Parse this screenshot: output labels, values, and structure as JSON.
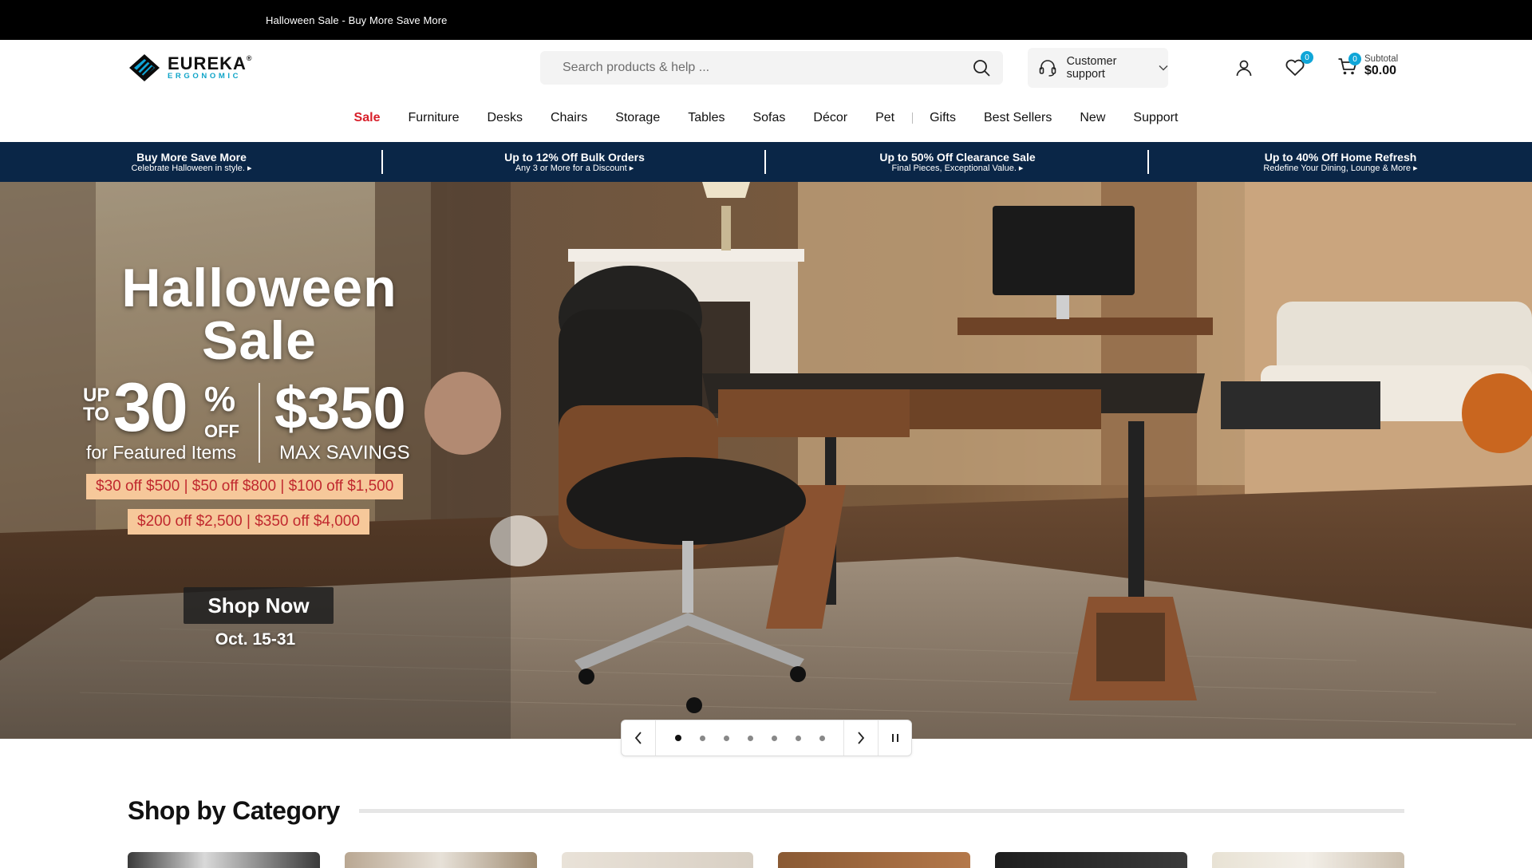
{
  "announcement": "Halloween Sale - Buy More Save More",
  "logo": {
    "brand": "EUREKA",
    "registered": "®",
    "subtitle": "ERGONOMIC"
  },
  "search": {
    "placeholder": "Search products & help ..."
  },
  "support": {
    "label": "Customer support"
  },
  "wishlist": {
    "count": "0"
  },
  "cart": {
    "count": "0",
    "subtotal_label": "Subtotal",
    "subtotal_value": "$0.00"
  },
  "nav": [
    "Sale",
    "Furniture",
    "Desks",
    "Chairs",
    "Storage",
    "Tables",
    "Sofas",
    "Décor",
    "Pet",
    "Gifts",
    "Best Sellers",
    "New",
    "Support"
  ],
  "promos": [
    {
      "title": "Buy More Save More",
      "subtitle": "Celebrate Halloween in style. ▸"
    },
    {
      "title": "Up to 12% Off Bulk Orders",
      "subtitle": "Any 3 or More for a Discount ▸"
    },
    {
      "title": "Up to 50% Off Clearance Sale",
      "subtitle": "Final Pieces, Exceptional Value. ▸"
    },
    {
      "title": "Up to 40% Off Home Refresh",
      "subtitle": "Redefine Your Dining, Lounge & More ▸"
    }
  ],
  "hero": {
    "title_line1": "Halloween",
    "title_line2": "Sale",
    "upto_line1": "UP",
    "upto_line2": "TO",
    "percent": "30",
    "percent_sign": "%",
    "off": "OFF",
    "featured": "for Featured Items",
    "max_value": "$350",
    "max_label": "MAX SAVINGS",
    "tier1": "$30 off $500 | $50 off $800 | $100 off $1,500",
    "tier2": "$200 off $2,500 | $350 off $4,000",
    "cta": "Shop Now",
    "dates": "Oct. 15-31"
  },
  "carousel": {
    "slides": 7,
    "active": 1
  },
  "categories": {
    "heading": "Shop by Category"
  },
  "colors": {
    "accent": "#10a6d8",
    "sale": "#d81f2a",
    "promo_bg": "#0a2647",
    "tier_bg": "#f6c89a",
    "tier_text": "#c0282e"
  }
}
